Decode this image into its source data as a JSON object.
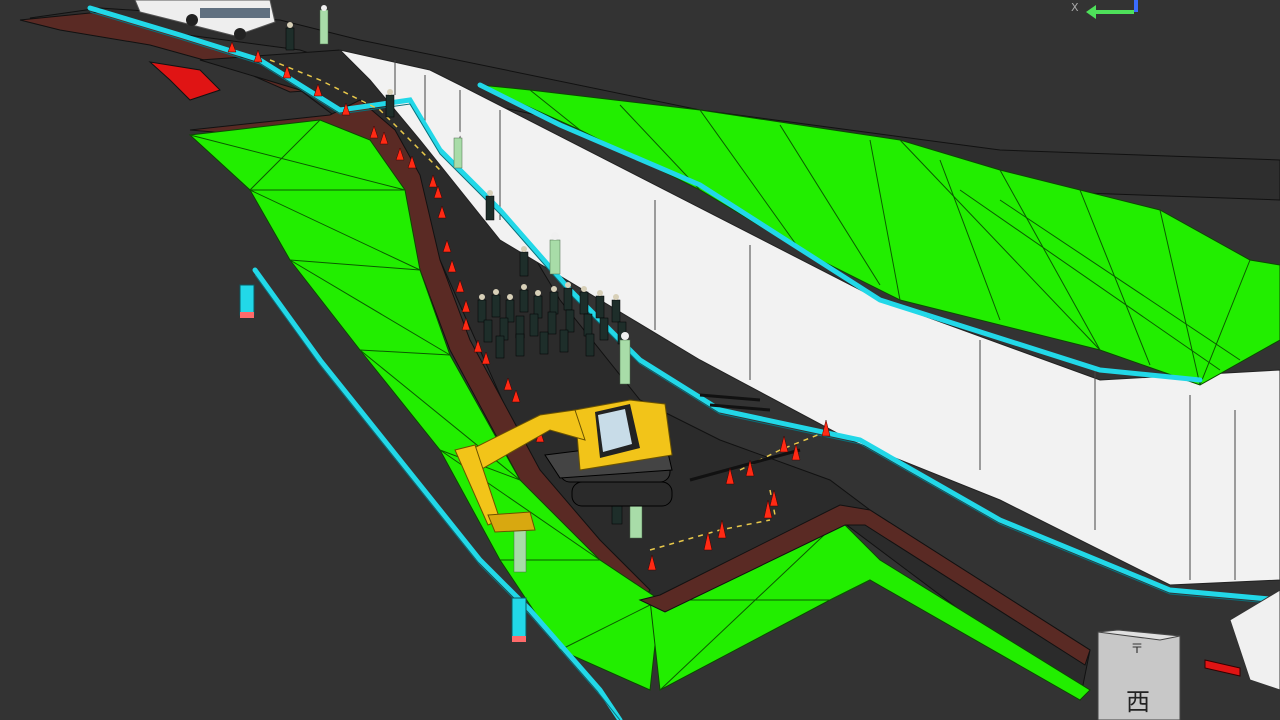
{
  "viewport": {
    "axis_label_x": "X",
    "sign_character": "西",
    "sign_sub_mark": "〒"
  },
  "colors": {
    "background": "#333333",
    "road": "#2b2b2b",
    "slope_green": "#22ee00",
    "wall_white": "#f2f2f2",
    "railing_cyan": "#22d8e8",
    "curb_brown": "#5a2a24",
    "cone_red": "#ff2a14",
    "excavator_yellow": "#f2c419",
    "worker_vest": "#a8dca8",
    "axis_green": "#4ee05a",
    "axis_blue": "#3a6cff"
  },
  "icons": {
    "axis_gizmo": "xyz-axis-icon",
    "excavator": "excavator-icon",
    "bus": "bus-icon",
    "cone": "traffic-cone-icon",
    "person": "person-icon",
    "sign": "signpost-icon"
  }
}
